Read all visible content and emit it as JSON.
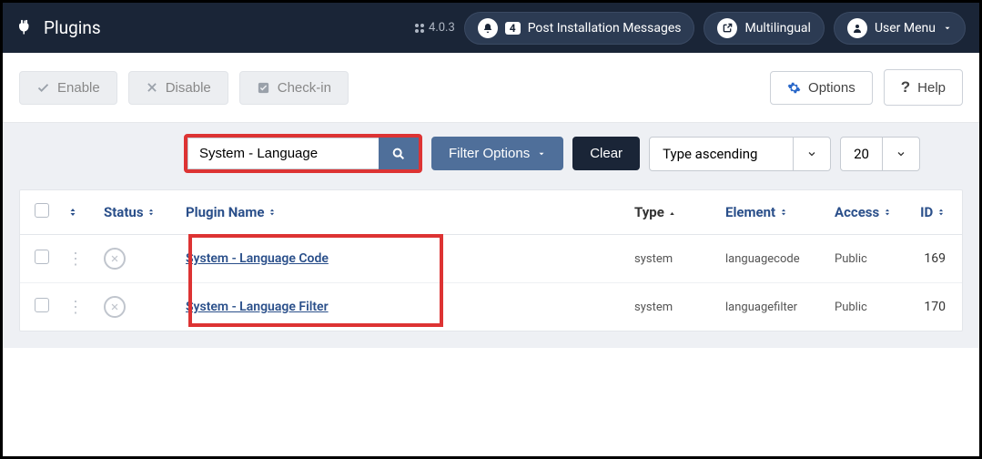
{
  "header": {
    "title": "Plugins",
    "version": "4.0.3",
    "notif_count": "4",
    "post_install": "Post Installation Messages",
    "multilingual": "Multilingual",
    "user_menu": "User Menu"
  },
  "toolbar": {
    "enable": "Enable",
    "disable": "Disable",
    "checkin": "Check-in",
    "options": "Options",
    "help": "Help"
  },
  "filters": {
    "search_value": "System - Language",
    "filter_options": "Filter Options",
    "clear": "Clear",
    "sort": "Type ascending",
    "limit": "20"
  },
  "columns": {
    "status": "Status",
    "plugin_name": "Plugin Name",
    "type": "Type",
    "element": "Element",
    "access": "Access",
    "id": "ID"
  },
  "rows": [
    {
      "name": "System - Language Code",
      "type": "system",
      "element": "languagecode",
      "access": "Public",
      "id": "169"
    },
    {
      "name": "System - Language Filter",
      "type": "system",
      "element": "languagefilter",
      "access": "Public",
      "id": "170"
    }
  ]
}
